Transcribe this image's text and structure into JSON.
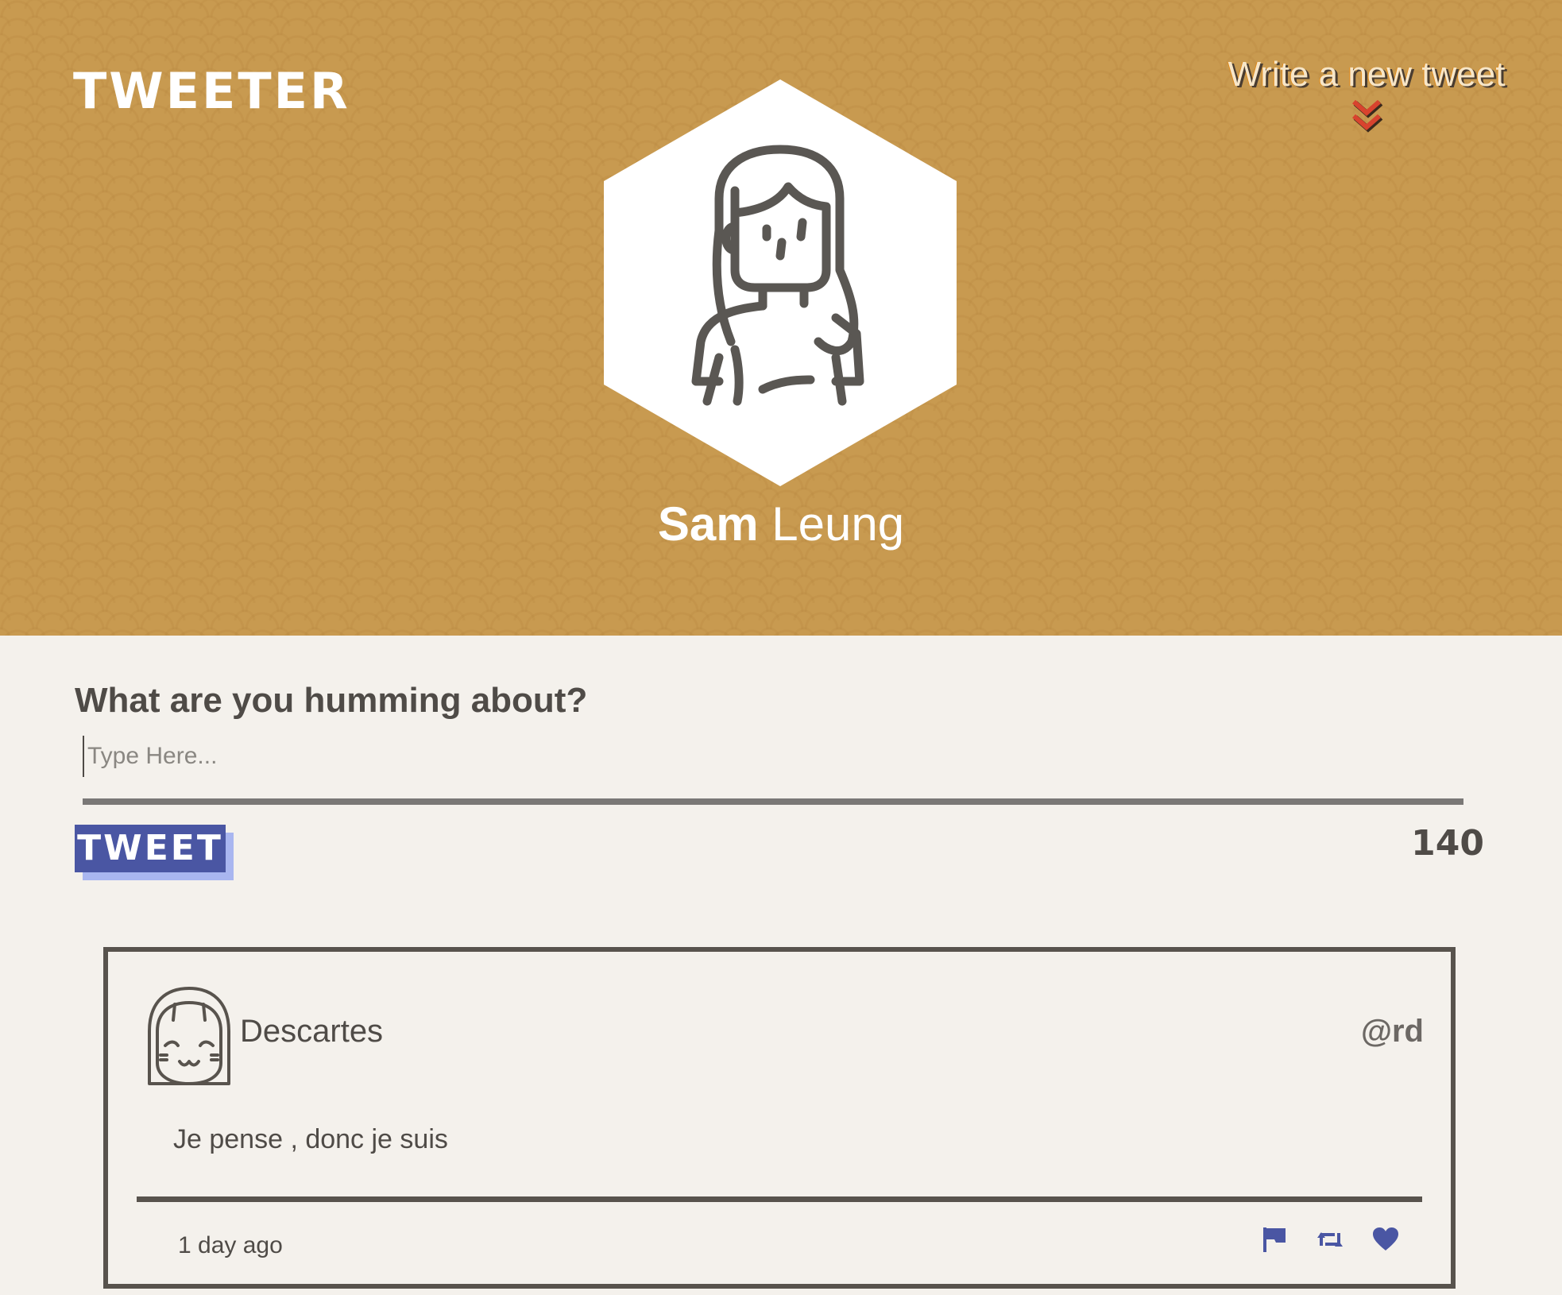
{
  "header": {
    "logo": "TWEETER",
    "compose_toggle_label": "Write a new tweet",
    "compose_toggle_icon": "double-chevron-down-icon",
    "avatar_icon": "woman-avatar-icon",
    "profile": {
      "first_name": "Sam",
      "last_name": "Leung"
    }
  },
  "compose": {
    "title": "What are you humming about?",
    "placeholder": "Type Here...",
    "value": "",
    "button_label": "TWEET",
    "counter": "140"
  },
  "tweets": [
    {
      "author": "Descartes",
      "handle": "@rd",
      "avatar_icon": "girl-avatar-icon",
      "body": "Je pense , donc je suis",
      "time": "1 day ago",
      "actions": [
        "flag-icon",
        "retweet-icon",
        "heart-icon"
      ]
    }
  ],
  "colors": {
    "header_bg": "#c89a50",
    "page_bg": "#f4f1ec",
    "text_dark": "#4f4b47",
    "accent_blue": "#4a56a3",
    "accent_blue_shadow": "#a9b6f0",
    "chevron_red": "#d8432e",
    "card_border": "#58534d"
  }
}
